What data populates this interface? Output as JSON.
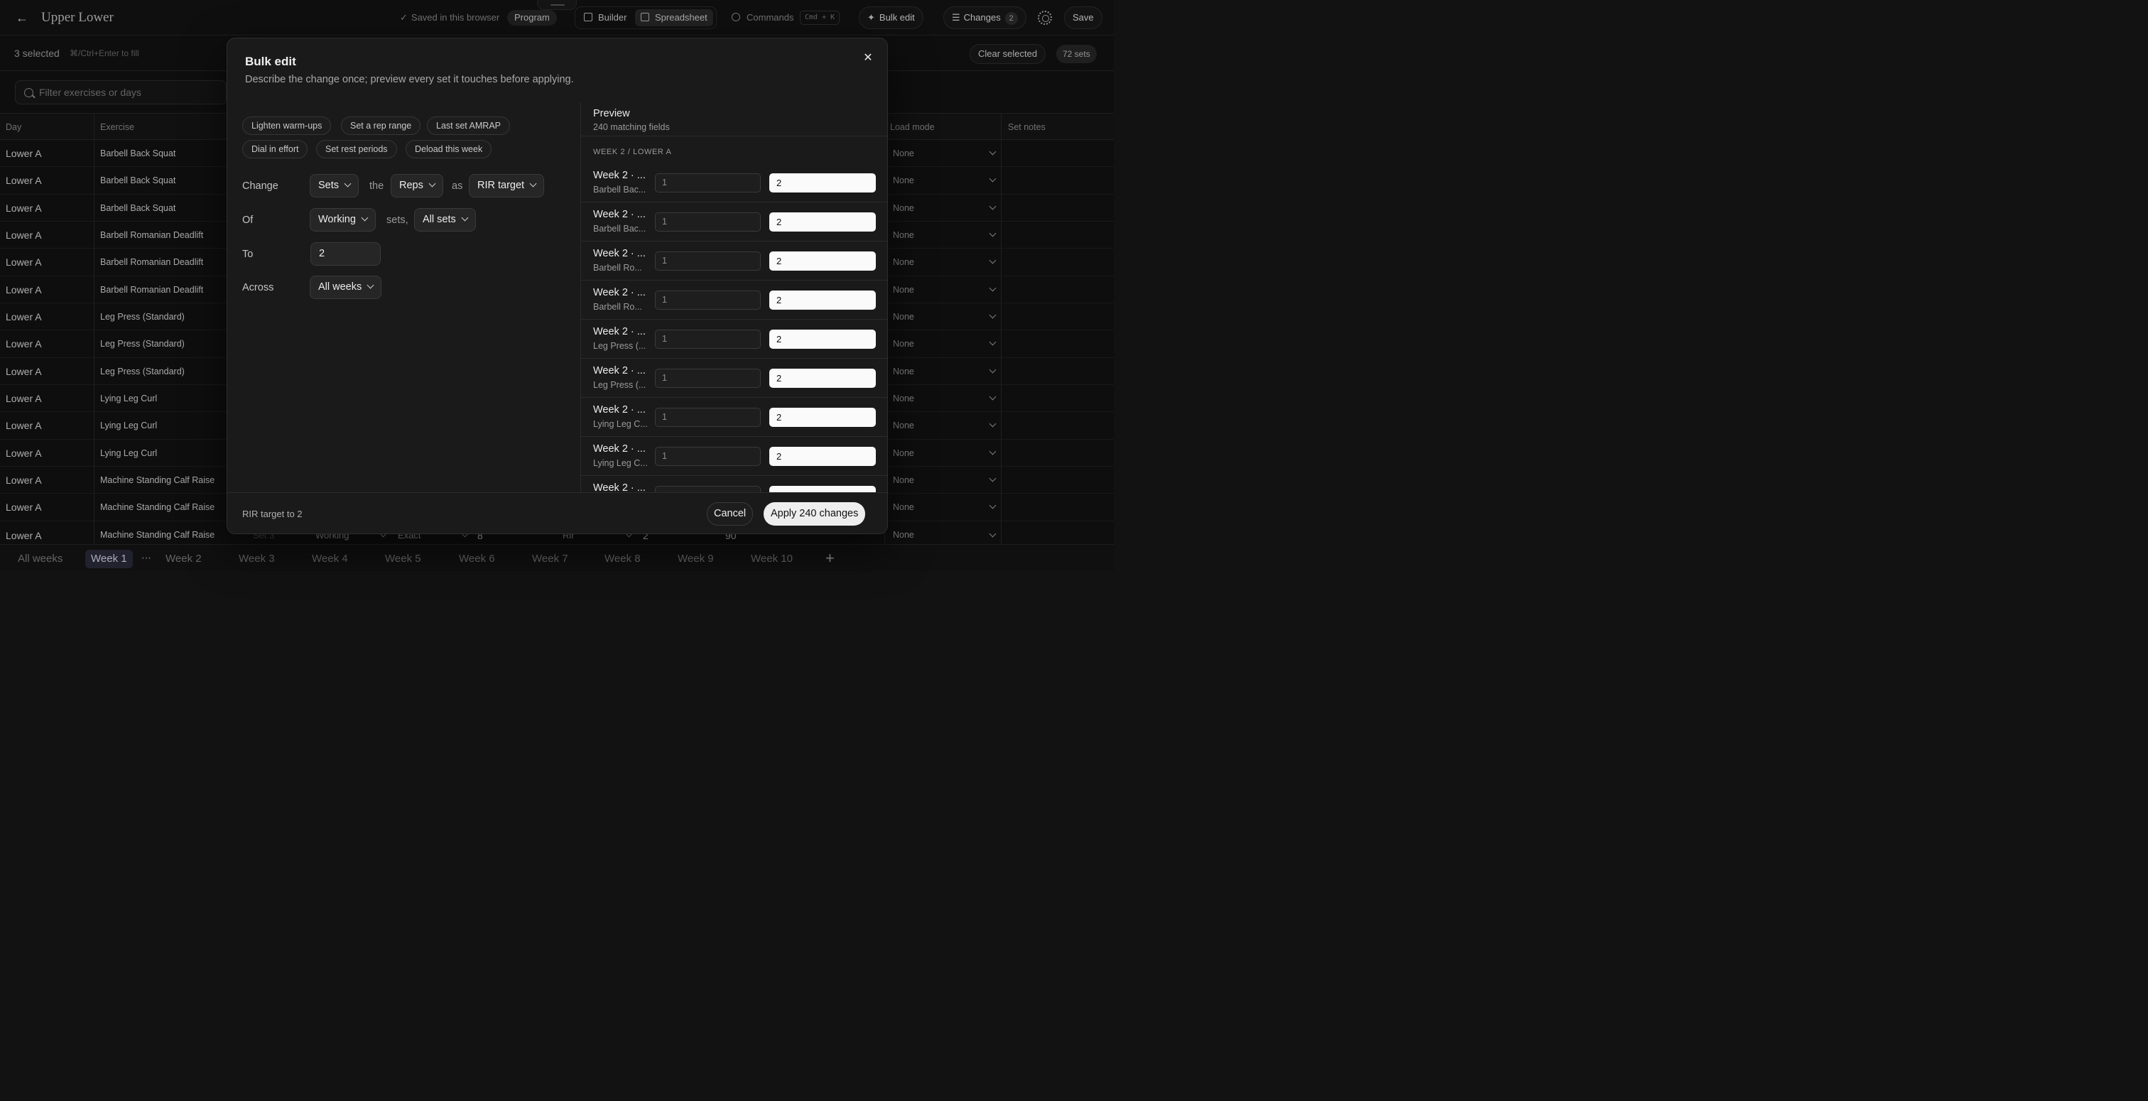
{
  "header": {
    "title": "Upper Lower",
    "saved_status": "Saved in this browser",
    "program_label": "Program",
    "views": [
      "Builder",
      "Spreadsheet"
    ],
    "commands_label": "Commands",
    "commands_shortcut": "Cmd + K",
    "bulk_edit_label": "Bulk edit",
    "changes_label": "Changes",
    "changes_count": "2",
    "save_label": "Save"
  },
  "selection": {
    "count_text": "3 selected",
    "hint": "⌘/Ctrl+Enter to fill",
    "clear_label": "Clear selected",
    "sets_count": "72 sets"
  },
  "filter": {
    "placeholder": "Filter exercises or days"
  },
  "grid": {
    "headers": {
      "day": "Day",
      "exercise": "Exercise",
      "load_mode": "Load mode",
      "set_notes": "Set notes"
    },
    "rows": [
      {
        "day": "Lower A",
        "exercise": "Barbell Back Squat",
        "load_mode": "None"
      },
      {
        "day": "Lower A",
        "exercise": "Barbell Back Squat",
        "load_mode": "None"
      },
      {
        "day": "Lower A",
        "exercise": "Barbell Back Squat",
        "load_mode": "None"
      },
      {
        "day": "Lower A",
        "exercise": "Barbell Romanian Deadlift",
        "load_mode": "None"
      },
      {
        "day": "Lower A",
        "exercise": "Barbell Romanian Deadlift",
        "load_mode": "None"
      },
      {
        "day": "Lower A",
        "exercise": "Barbell Romanian Deadlift",
        "load_mode": "None"
      },
      {
        "day": "Lower A",
        "exercise": "Leg Press (Standard)",
        "load_mode": "None"
      },
      {
        "day": "Lower A",
        "exercise": "Leg Press (Standard)",
        "load_mode": "None"
      },
      {
        "day": "Lower A",
        "exercise": "Leg Press (Standard)",
        "load_mode": "None"
      },
      {
        "day": "Lower A",
        "exercise": "Lying Leg Curl",
        "load_mode": "None"
      },
      {
        "day": "Lower A",
        "exercise": "Lying Leg Curl",
        "load_mode": "None"
      },
      {
        "day": "Lower A",
        "exercise": "Lying Leg Curl",
        "load_mode": "None"
      },
      {
        "day": "Lower A",
        "exercise": "Machine Standing Calf Raise",
        "load_mode": "None"
      },
      {
        "day": "Lower A",
        "exercise": "Machine Standing Calf Raise",
        "load_mode": "None"
      }
    ],
    "last_row": {
      "day": "Lower A",
      "exercise": "Machine Standing Calf Raise",
      "set": "Set 3",
      "set_type": "Working",
      "rep_mode": "Exact",
      "reps": "8",
      "effort_type": "Rir",
      "effort": "2",
      "rest": "90",
      "load_mode": "None"
    }
  },
  "week_tabs": [
    "All weeks",
    "Week 1",
    "Week 2",
    "Week 3",
    "Week 4",
    "Week 5",
    "Week 6",
    "Week 7",
    "Week 8",
    "Week 9",
    "Week 10"
  ],
  "modal": {
    "title": "Bulk edit",
    "subtitle": "Describe the change once; preview every set it touches before applying.",
    "presets": [
      "Lighten warm-ups",
      "Set a rep range",
      "Last set AMRAP",
      "Dial in effort",
      "Set rest periods",
      "Deload this week"
    ],
    "form": {
      "change_label": "Change",
      "change_target": "Sets",
      "the_word": "the",
      "field": "Reps",
      "as_word": "as",
      "as_value": "RIR target",
      "of_label": "Of",
      "set_type": "Working",
      "sets_word": "sets,",
      "set_scope": "All sets",
      "to_label": "To",
      "to_value": "2",
      "across_label": "Across",
      "across_value": "All weeks"
    },
    "preview": {
      "title": "Preview",
      "count": "240 matching fields",
      "group": "WEEK 2 / LOWER A",
      "rows": [
        {
          "line1": "Week 2 · ...",
          "line2": "Barbell Bac...",
          "old": "1",
          "new": "2"
        },
        {
          "line1": "Week 2 · ...",
          "line2": "Barbell Bac...",
          "old": "1",
          "new": "2"
        },
        {
          "line1": "Week 2 · ...",
          "line2": "Barbell Ro...",
          "old": "1",
          "new": "2"
        },
        {
          "line1": "Week 2 · ...",
          "line2": "Barbell Ro...",
          "old": "1",
          "new": "2"
        },
        {
          "line1": "Week 2 · ...",
          "line2": "Leg Press (...",
          "old": "1",
          "new": "2"
        },
        {
          "line1": "Week 2 · ...",
          "line2": "Leg Press (...",
          "old": "1",
          "new": "2"
        },
        {
          "line1": "Week 2 · ...",
          "line2": "Lying Leg C...",
          "old": "1",
          "new": "2"
        },
        {
          "line1": "Week 2 · ...",
          "line2": "Lying Leg C...",
          "old": "1",
          "new": "2"
        },
        {
          "line1": "Week 2 · ...",
          "line2": "",
          "old": "",
          "new": ""
        }
      ]
    },
    "footer": {
      "summary": "RIR target to 2",
      "cancel": "Cancel",
      "apply": "Apply 240 changes"
    }
  }
}
